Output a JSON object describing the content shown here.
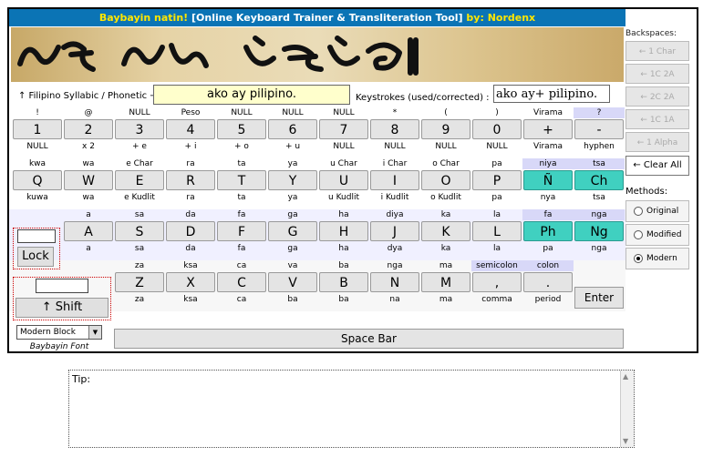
{
  "title": {
    "part1": "Baybayin natin!",
    "part2": "[Online Keyboard Trainer & Transliteration Tool]",
    "part3": "by:",
    "part4": "Nordenx"
  },
  "banner": {
    "icon": "baybayin-script-banner"
  },
  "inputs": {
    "syllabic_label": "↑ Filipino Syllabic / Phonetic →",
    "syllabic_value": "ako ay pilipino.",
    "keystrokes_label": "Keystrokes (used/corrected) :",
    "keystrokes_value": "ako ay+ pilipino."
  },
  "sidebar": {
    "backspaces_label": "Backspaces:",
    "backspaces": [
      "← 1 Char",
      "← 1C 2A",
      "← 2C 2A",
      "← 1C 1A",
      "← 1 Alpha"
    ],
    "clear_all": "← Clear All",
    "methods_label": "Methods:",
    "methods": [
      {
        "label": "Original",
        "selected": false
      },
      {
        "label": "Modified",
        "selected": false
      },
      {
        "label": "Modern",
        "selected": true
      }
    ]
  },
  "rows": [
    {
      "keys": [
        {
          "top": "!",
          "key": "1",
          "bot": "NULL"
        },
        {
          "top": "@",
          "key": "2",
          "bot": "x 2"
        },
        {
          "top": "NULL",
          "key": "3",
          "bot": "+ e"
        },
        {
          "top": "Peso",
          "key": "4",
          "bot": "+ i"
        },
        {
          "top": "NULL",
          "key": "5",
          "bot": "+ o"
        },
        {
          "top": "NULL",
          "key": "6",
          "bot": "+ u"
        },
        {
          "top": "NULL",
          "key": "7",
          "bot": "NULL"
        },
        {
          "top": "*",
          "key": "8",
          "bot": "NULL"
        },
        {
          "top": "(",
          "key": "9",
          "bot": "NULL"
        },
        {
          "top": ")",
          "key": "0",
          "bot": "NULL"
        },
        {
          "top": "Virama",
          "key": "+",
          "bot": "Virama"
        },
        {
          "top": "?",
          "key": "-",
          "bot": "hyphen",
          "hl": true
        }
      ]
    },
    {
      "keys": [
        {
          "top": "kwa",
          "key": "Q",
          "bot": "kuwa"
        },
        {
          "top": "wa",
          "key": "W",
          "bot": "wa"
        },
        {
          "top": "e Char",
          "key": "E",
          "bot": "e Kudlit"
        },
        {
          "top": "ra",
          "key": "R",
          "bot": "ra"
        },
        {
          "top": "ta",
          "key": "T",
          "bot": "ta"
        },
        {
          "top": "ya",
          "key": "Y",
          "bot": "ya"
        },
        {
          "top": "u Char",
          "key": "U",
          "bot": "u Kudlit"
        },
        {
          "top": "i Char",
          "key": "I",
          "bot": "i Kudlit"
        },
        {
          "top": "o Char",
          "key": "O",
          "bot": "o Kudlit"
        },
        {
          "top": "pa",
          "key": "P",
          "bot": "pa"
        },
        {
          "top": "niya",
          "key": "Ñ",
          "bot": "nya",
          "hl": true,
          "teal": true
        },
        {
          "top": "tsa",
          "key": "Ch",
          "bot": "tsa",
          "hl": true,
          "teal": true
        }
      ]
    },
    {
      "keys": [
        {
          "top": "a",
          "key": "A",
          "bot": "a"
        },
        {
          "top": "sa",
          "key": "S",
          "bot": "sa"
        },
        {
          "top": "da",
          "key": "D",
          "bot": "da"
        },
        {
          "top": "fa",
          "key": "F",
          "bot": "fa"
        },
        {
          "top": "ga",
          "key": "G",
          "bot": "ga"
        },
        {
          "top": "ha",
          "key": "H",
          "bot": "ha"
        },
        {
          "top": "diya",
          "key": "J",
          "bot": "dya"
        },
        {
          "top": "ka",
          "key": "K",
          "bot": "ka"
        },
        {
          "top": "la",
          "key": "L",
          "bot": "la"
        },
        {
          "top": "fa",
          "key": "Ph",
          "bot": "pa",
          "hl": true,
          "teal": true
        },
        {
          "top": "nga",
          "key": "Ng",
          "bot": "nga",
          "hl": true,
          "teal": true
        }
      ]
    },
    {
      "keys": [
        {
          "top": "za",
          "key": "Z",
          "bot": "za"
        },
        {
          "top": "ksa",
          "key": "X",
          "bot": "ksa"
        },
        {
          "top": "ca",
          "key": "C",
          "bot": "ca"
        },
        {
          "top": "va",
          "key": "V",
          "bot": "ba"
        },
        {
          "top": "ba",
          "key": "B",
          "bot": "ba"
        },
        {
          "top": "nga",
          "key": "N",
          "bot": "na"
        },
        {
          "top": "ma",
          "key": "M",
          "bot": "ma"
        },
        {
          "top": "semicolon",
          "key": ",",
          "bot": "comma",
          "hl": true
        },
        {
          "top": "colon",
          "key": ".",
          "bot": "period",
          "hl": true
        }
      ]
    }
  ],
  "lock": {
    "label": "Lock"
  },
  "shift": {
    "label": "↑ Shift"
  },
  "enter": {
    "label": "Enter"
  },
  "spacebar": {
    "label": "Space Bar"
  },
  "font": {
    "selected": "Modern Block",
    "caption": "Baybayin Font"
  },
  "tip": {
    "label": "Tip:"
  }
}
